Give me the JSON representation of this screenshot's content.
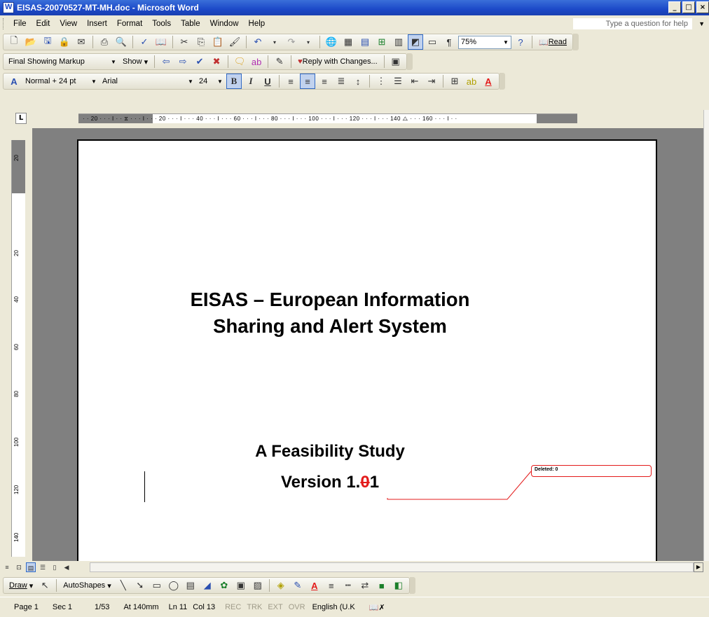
{
  "window": {
    "title": "EISAS-20070527-MT-MH.doc - Microsoft Word",
    "minimize": "_",
    "maximize": "□",
    "close": "×"
  },
  "menu": {
    "items": [
      "File",
      "Edit",
      "View",
      "Insert",
      "Format",
      "Tools",
      "Table",
      "Window",
      "Help"
    ],
    "help_placeholder": "Type a question for help"
  },
  "standard_toolbar": {
    "zoom": "75%",
    "read_label": "Read"
  },
  "reviewing_toolbar": {
    "display_mode": "Final Showing Markup",
    "show_label": "Show",
    "reply_label": "Reply with Changes..."
  },
  "formatting_toolbar": {
    "style": "Normal + 24 pt",
    "font": "Arial",
    "size": "24",
    "bold": "B",
    "italic": "I",
    "underline": "U"
  },
  "ruler": {
    "ticks": "· · 20 · · · I · · ⧖ · · · I · · · 20 · · · I · · · 40 · · · I · · · 60 · · · I · · · 80 · · · I · · · 100 · · · I · · · 120 · · · I · · · 140 ⧍ · · · 160 · · · I · ·",
    "vertical_labels": [
      "20",
      "20",
      "40",
      "60",
      "80",
      "100",
      "120",
      "140"
    ]
  },
  "document": {
    "title_line1": "EISAS – European Information",
    "title_line2": "Sharing and Alert System",
    "subtitle": "A Feasibility Study",
    "version_prefix": "Version 1.",
    "version_deleted": "0",
    "version_inserted": "1",
    "comment_balloon": "Deleted: 0"
  },
  "drawing_toolbar": {
    "draw_label": "Draw",
    "autoshapes_label": "AutoShapes"
  },
  "status": {
    "page": "Page 1",
    "section": "Sec 1",
    "page_count": "1/53",
    "position": "At 140mm",
    "line": "Ln 11",
    "column": "Col 13",
    "rec": "REC",
    "trk": "TRK",
    "ext": "EXT",
    "ovr": "OVR",
    "language": "English (U.K"
  }
}
